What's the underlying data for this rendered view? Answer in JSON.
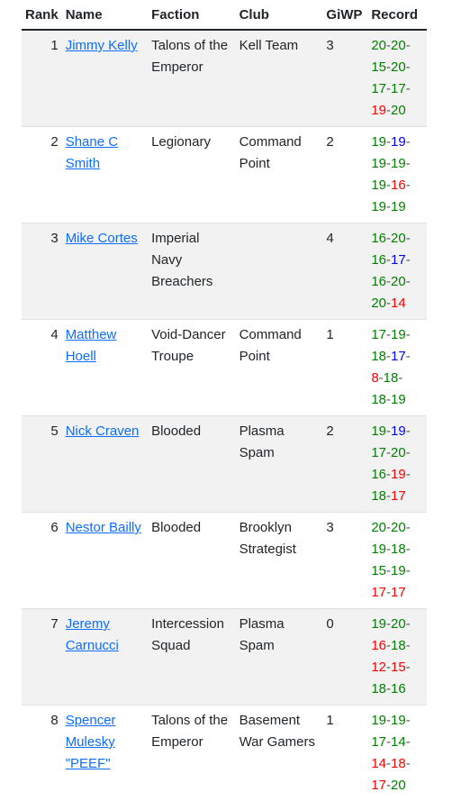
{
  "headers": {
    "rank": "Rank",
    "name": "Name",
    "faction": "Faction",
    "club": "Club",
    "giwp": "GiWP",
    "record": "Record"
  },
  "colors": {
    "win": "#008000",
    "loss": "#ff0000",
    "draw": "#0000ff",
    "link": "#0d6efd",
    "stripe": "#f2f2f2"
  },
  "rows": [
    {
      "rank": "1",
      "name": "Jimmy Kelly",
      "faction": "Talons of the Emperor",
      "club": "Kell Team",
      "giwp": "3",
      "record": [
        [
          "20",
          "w"
        ],
        [
          "20",
          "w"
        ],
        [
          "15",
          "w"
        ],
        [
          "20",
          "w"
        ],
        [
          "17",
          "w"
        ],
        [
          "17",
          "w"
        ],
        [
          "19",
          "l"
        ],
        [
          "20",
          "w"
        ]
      ]
    },
    {
      "rank": "2",
      "name": "Shane C Smith",
      "faction": "Legionary",
      "club": "Command Point",
      "giwp": "2",
      "record": [
        [
          "19",
          "w"
        ],
        [
          "19",
          "d"
        ],
        [
          "19",
          "w"
        ],
        [
          "19",
          "w"
        ],
        [
          "19",
          "w"
        ],
        [
          "16",
          "l"
        ],
        [
          "19",
          "w"
        ],
        [
          "19",
          "w"
        ]
      ]
    },
    {
      "rank": "3",
      "name": "Mike Cortes",
      "faction": "Imperial Navy Breachers",
      "club": "",
      "giwp": "4",
      "record": [
        [
          "16",
          "w"
        ],
        [
          "20",
          "w"
        ],
        [
          "16",
          "w"
        ],
        [
          "17",
          "d"
        ],
        [
          "16",
          "w"
        ],
        [
          "20",
          "w"
        ],
        [
          "20",
          "w"
        ],
        [
          "14",
          "l"
        ]
      ]
    },
    {
      "rank": "4",
      "name": "Matthew Hoell",
      "faction": "Void-Dancer Troupe",
      "club": "Command Point",
      "giwp": "1",
      "record": [
        [
          "17",
          "w"
        ],
        [
          "19",
          "w"
        ],
        [
          "18",
          "w"
        ],
        [
          "17",
          "d"
        ],
        [
          "8",
          "l"
        ],
        [
          "18",
          "w"
        ],
        [
          "18",
          "w"
        ],
        [
          "19",
          "w"
        ]
      ]
    },
    {
      "rank": "5",
      "name": "Nick Craven",
      "faction": "Blooded",
      "club": "Plasma Spam",
      "giwp": "2",
      "record": [
        [
          "19",
          "w"
        ],
        [
          "19",
          "d"
        ],
        [
          "17",
          "w"
        ],
        [
          "20",
          "w"
        ],
        [
          "16",
          "w"
        ],
        [
          "19",
          "l"
        ],
        [
          "18",
          "w"
        ],
        [
          "17",
          "l"
        ]
      ]
    },
    {
      "rank": "6",
      "name": "Nestor Bailly",
      "faction": "Blooded",
      "club": "Brooklyn Strategist",
      "giwp": "3",
      "record": [
        [
          "20",
          "w"
        ],
        [
          "20",
          "w"
        ],
        [
          "19",
          "w"
        ],
        [
          "18",
          "w"
        ],
        [
          "15",
          "w"
        ],
        [
          "19",
          "w"
        ],
        [
          "17",
          "l"
        ],
        [
          "17",
          "l"
        ]
      ]
    },
    {
      "rank": "7",
      "name": "Jeremy Carnucci",
      "faction": "Intercession Squad",
      "club": "Plasma Spam",
      "giwp": "0",
      "record": [
        [
          "19",
          "w"
        ],
        [
          "20",
          "w"
        ],
        [
          "16",
          "l"
        ],
        [
          "18",
          "w"
        ],
        [
          "12",
          "l"
        ],
        [
          "15",
          "l"
        ],
        [
          "18",
          "w"
        ],
        [
          "16",
          "w"
        ]
      ]
    },
    {
      "rank": "8",
      "name": "Spencer Mulesky \"PEEF\"",
      "faction": "Talons of the Emperor",
      "club": "Basement War Gamers",
      "giwp": "1",
      "record": [
        [
          "19",
          "w"
        ],
        [
          "19",
          "w"
        ],
        [
          "17",
          "w"
        ],
        [
          "14",
          "w"
        ],
        [
          "14",
          "l"
        ],
        [
          "18",
          "l"
        ],
        [
          "17",
          "l"
        ],
        [
          "20",
          "w"
        ]
      ]
    }
  ]
}
